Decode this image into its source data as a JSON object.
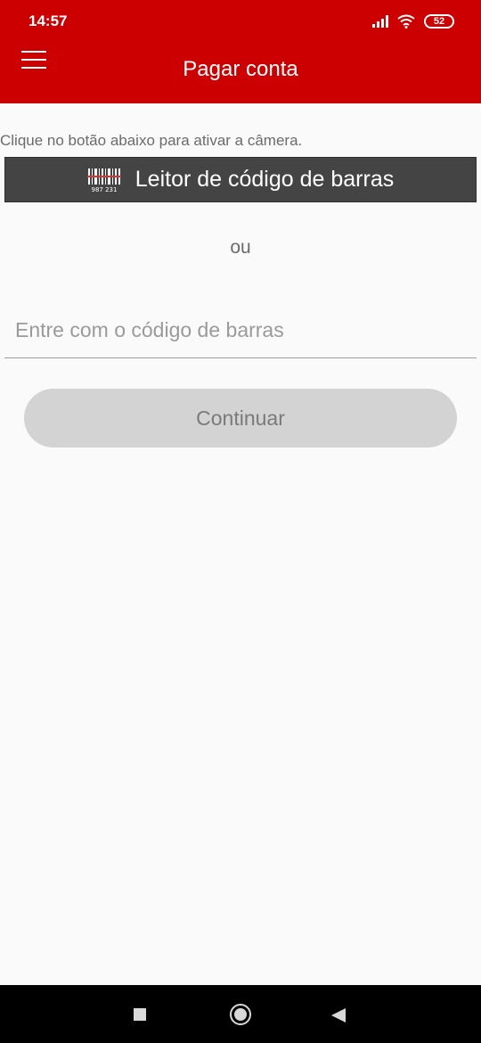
{
  "status_bar": {
    "time": "14:57",
    "battery": "52",
    "icons": [
      "signal-icon",
      "wifi-icon",
      "battery-icon"
    ]
  },
  "header": {
    "title": "Pagar conta",
    "menu_icon": "menu-icon",
    "background_color": "#cc0000"
  },
  "main": {
    "hint": "Clique no botão abaixo para ativar a câmera.",
    "scan_button_label": "Leitor de código de barras",
    "scan_icon": "barcode-icon",
    "barcode_icon_digits": "987 231",
    "or_text": "ou",
    "barcode_input": {
      "value": "",
      "placeholder": "Entre com o código de barras"
    },
    "continue_label": "Continuar"
  },
  "nav_bar": {
    "icons": [
      "recent-apps-icon",
      "home-icon",
      "back-icon"
    ]
  }
}
